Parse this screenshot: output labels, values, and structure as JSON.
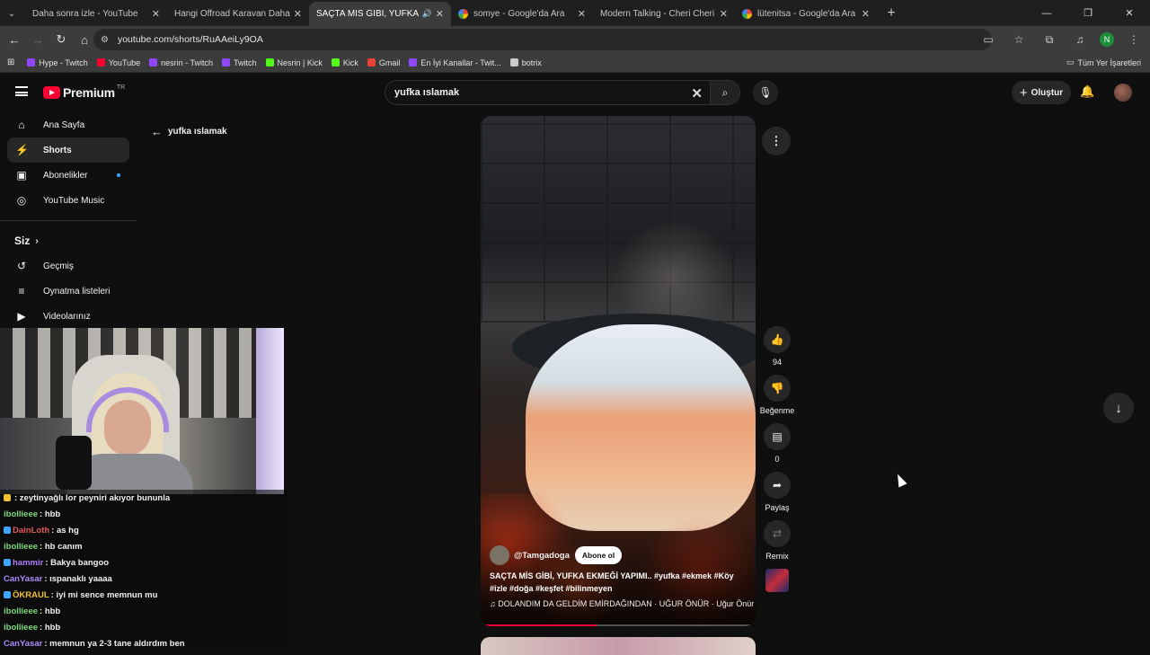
{
  "tabs": [
    {
      "title": "Daha sonra izle - YouTube",
      "fav": "yt",
      "active": false
    },
    {
      "title": "Hangi Offroad Karavan Daha İyi",
      "fav": "yt",
      "active": false
    },
    {
      "title": "SAÇTA MİS GİBİ, YUFKA EKMEĞİ",
      "fav": "yt",
      "active": true
    },
    {
      "title": "somye - Google'da Ara",
      "fav": "g",
      "active": false
    },
    {
      "title": "Modern Talking - Cheri Cheri La",
      "fav": "yt",
      "active": false
    },
    {
      "title": "lütenitsa - Google'da Ara",
      "fav": "g",
      "active": false
    }
  ],
  "browser": {
    "url": "youtube.com/shorts/RuAAeiLy9OA",
    "profile_initial": "N",
    "all_bookmarks": "Tüm Yer İşaretleri"
  },
  "bookmarks": [
    {
      "label": "Hype - Twitch",
      "color": "#9146ff"
    },
    {
      "label": "YouTube",
      "color": "#ff0033"
    },
    {
      "label": "nesrin - Twitch",
      "color": "#9146ff"
    },
    {
      "label": "Twitch",
      "color": "#9146ff"
    },
    {
      "label": "Nesrin | Kick",
      "color": "#53fc18"
    },
    {
      "label": "Kick",
      "color": "#53fc18"
    },
    {
      "label": "Gmail",
      "color": "#ea4335"
    },
    {
      "label": "En İyi Kanallar - Twit...",
      "color": "#9146ff"
    },
    {
      "label": "botrix",
      "color": "#cccccc"
    }
  ],
  "youtube": {
    "logo_text": "Premium",
    "logo_region": "TR",
    "search_value": "yufka ıslamak",
    "create_label": "Oluştur",
    "back_label": "yufka ıslamak"
  },
  "sidebar": {
    "items": [
      {
        "label": "Ana Sayfa",
        "icon": "⌂",
        "name": "home"
      },
      {
        "label": "Shorts",
        "icon": "⚡",
        "name": "shorts",
        "selected": true
      },
      {
        "label": "Abonelikler",
        "icon": "▣",
        "name": "subscriptions",
        "dot": true
      },
      {
        "label": "YouTube Music",
        "icon": "◎",
        "name": "youtube-music"
      }
    ],
    "you_heading": "Siz",
    "you_items": [
      {
        "label": "Geçmiş",
        "icon": "↺",
        "name": "history"
      },
      {
        "label": "Oynatma listeleri",
        "icon": "≡",
        "name": "playlists"
      },
      {
        "label": "Videolarınız",
        "icon": "▶",
        "name": "your-videos"
      }
    ]
  },
  "short": {
    "channel": "@Tamgadoga",
    "subscribe_label": "Abone ol",
    "description": "SAÇTA MİS GİBİ, YUFKA EKMEĞİ YAPIMI..   #yufka #ekmek #Köy #izle #doğa #keşfet #bilinmeyen",
    "music": "♫  DOLANDIM DA GELDİM EMİRDAĞINDAN · UĞUR ÖNÜR · Uğur Önür",
    "progress": 0.42
  },
  "actions": {
    "like_count": "94",
    "dislike_label": "Beğenme",
    "comment_count": "0",
    "share_label": "Paylaş",
    "remix_label": "Remix"
  },
  "chat": [
    {
      "user": "",
      "text": ": zeytinyağlı lor peyniri akıyor bununla",
      "color": "#e05050",
      "badge": "#f0c030"
    },
    {
      "user": "ibollieee",
      "text": ": hbb",
      "color": "#7dd87d",
      "badge": ""
    },
    {
      "user": "DainLoth",
      "text": ": as hg",
      "color": "#e05a5a",
      "badge": "#3ea6ff"
    },
    {
      "user": "ibollieee",
      "text": ": hb canım",
      "color": "#7dd87d",
      "badge": ""
    },
    {
      "user": "hammir",
      "text": ": Bakya bangoo",
      "color": "#b07bff",
      "badge": "#3ea6ff"
    },
    {
      "user": "CanYasar",
      "text": ": ıspanaklı yaaaa",
      "color": "#a98cff",
      "badge": ""
    },
    {
      "user": "ÖKRAUL",
      "text": ": iyi mi sence memnun mu",
      "color": "#f0c030",
      "badge": "#3ea6ff"
    },
    {
      "user": "ibollieee",
      "text": ": hbb",
      "color": "#7dd87d",
      "badge": ""
    },
    {
      "user": "ibollieee",
      "text": ": hbb",
      "color": "#7dd87d",
      "badge": ""
    },
    {
      "user": "CanYasar",
      "text": ": memnun ya 2-3 tane aldırdım ben",
      "color": "#a98cff",
      "badge": ""
    }
  ],
  "colors": {
    "accent": "#ff0033",
    "link": "#3ea6ff"
  }
}
